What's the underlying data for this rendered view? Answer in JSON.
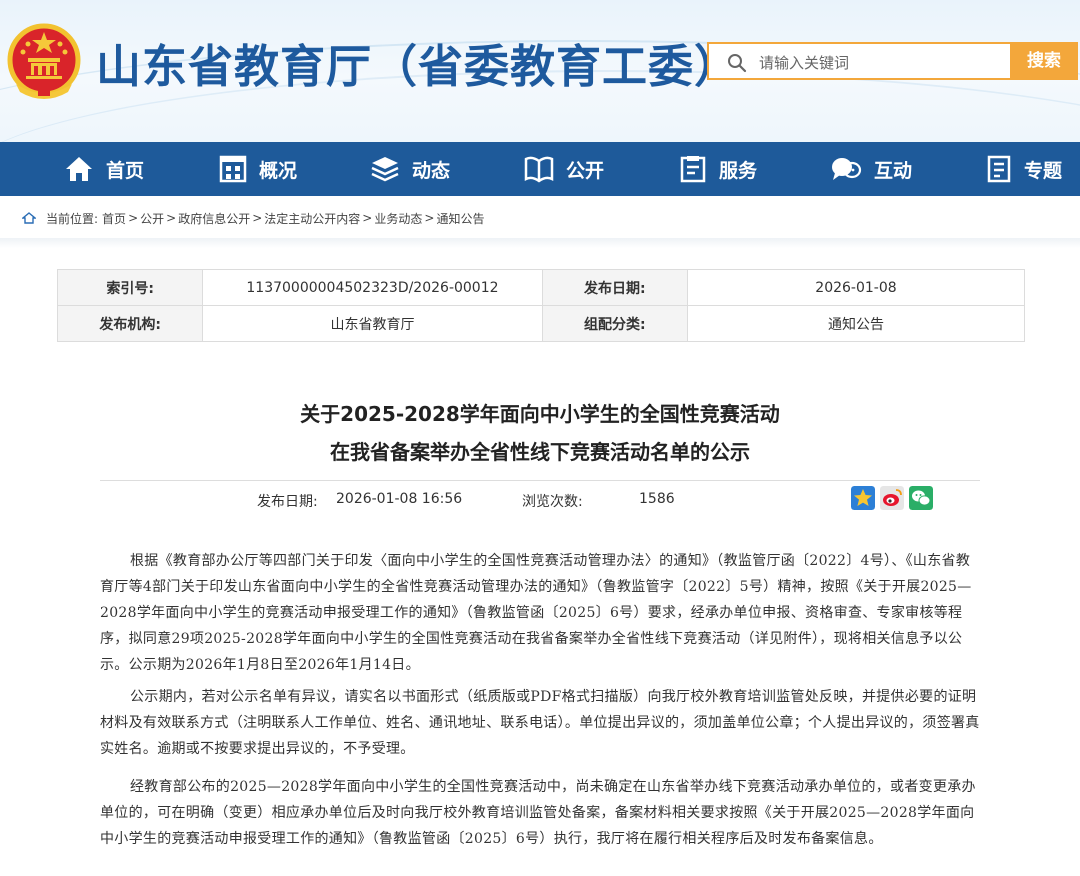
{
  "header": {
    "site_title": "山东省教育厅（省委教育工委）",
    "search_placeholder": "请输入关键词",
    "search_button": "搜索"
  },
  "nav": {
    "items": [
      {
        "label": "首页",
        "icon": "home-icon"
      },
      {
        "label": "概况",
        "icon": "building-icon"
      },
      {
        "label": "动态",
        "icon": "news-stack-icon"
      },
      {
        "label": "公开",
        "icon": "open-book-icon"
      },
      {
        "label": "服务",
        "icon": "service-doc-icon"
      },
      {
        "label": "互动",
        "icon": "chat-bubbles-icon"
      },
      {
        "label": "专题",
        "icon": "topic-doc-icon"
      }
    ]
  },
  "breadcrumb": {
    "prefix": "当前位置:",
    "items": [
      "首页",
      "公开",
      "政府信息公开",
      "法定主动公开内容",
      "业务动态",
      "通知公告"
    ]
  },
  "info": {
    "index_label": "索引号:",
    "index_value": "11370000004502323D/2026-00012",
    "date_label": "发布日期:",
    "date_value": "2026-01-08",
    "org_label": "发布机构:",
    "org_value": "山东省教育厅",
    "category_label": "组配分类:",
    "category_value": "通知公告"
  },
  "article": {
    "title_line1": "关于2025-2028学年面向中小学生的全国性竞赛活动",
    "title_line2": "在我省备案举办全省性线下竞赛活动名单的公示",
    "publish_label": "发布日期:",
    "publish_value": "2026-01-08 16:56",
    "views_label": "浏览次数:",
    "views_value": "1586",
    "paragraphs": [
      "根据《教育部办公厅等四部门关于印发〈面向中小学生的全国性竞赛活动管理办法〉的通知》（教监管厅函〔2022〕4号）、《山东省教育厅等4部门关于印发山东省面向中小学生的全省性竞赛活动管理办法的通知》（鲁教监管字〔2022〕5号）精神，按照《关于开展2025—2028学年面向中小学生的竞赛活动申报受理工作的通知》（鲁教监管函〔2025〕6号）要求，经承办单位申报、资格审查、专家审核等程序，拟同意29项2025-2028学年面向中小学生的全国性竞赛活动在我省备案举办全省性线下竞赛活动（详见附件），现将相关信息予以公示。公示期为2026年1月8日至2026年1月14日。",
      "公示期内，若对公示名单有异议，请实名以书面形式（纸质版或PDF格式扫描版）向我厅校外教育培训监管处反映，并提供必要的证明材料及有效联系方式（注明联系人工作单位、姓名、通讯地址、联系电话）。单位提出异议的，须加盖单位公章；个人提出异议的，须签署真实姓名。逾期或不按要求提出异议的，不予受理。",
      "经教育部公布的2025—2028学年面向中小学生的全国性竞赛活动中，尚未确定在山东省举办线下竞赛活动承办单位的，或者变更承办单位的，可在明确（变更）相应承办单位后及时向我厅校外教育培训监管处备案，备案材料相关要求按照《关于开展2025—2028学年面向中小学生的竞赛活动申报受理工作的通知》（鲁教监管函〔2025〕6号）执行，我厅将在履行相关程序后及时发布备案信息。"
    ]
  },
  "colors": {
    "brand_blue": "#1e5a9a",
    "search_orange": "#f3a73b"
  }
}
